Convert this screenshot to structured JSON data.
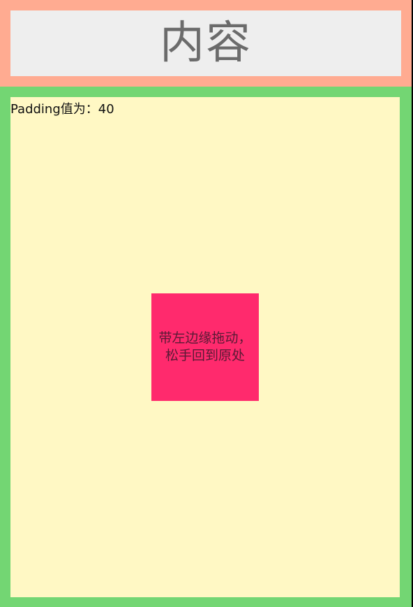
{
  "header": {
    "title": "内容"
  },
  "drag_area": {
    "padding_label": "Padding值为：40",
    "drag_box_text": "带左边缘拖动，松手回到原处"
  },
  "colors": {
    "header_frame": "#FFAB91",
    "header_bg": "#EEEEEE",
    "header_text": "#6B6B6B",
    "green_frame": "#73D673",
    "drag_area_bg": "#FFF8C4",
    "drag_box": "#FF2A6D"
  }
}
